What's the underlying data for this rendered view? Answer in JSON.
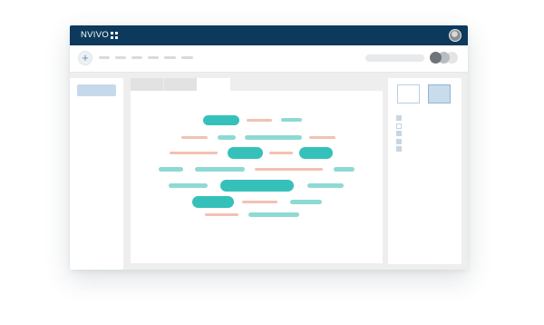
{
  "app": {
    "title": "NVIVO",
    "logo_icon": "nvivo-four-dots-icon"
  },
  "colors": {
    "titlebar": "#0d3a5c",
    "accent_teal": "#35c1b9",
    "teal_light": "#8ed9d4",
    "salmon": "#f2c1b2",
    "selected_blue": "#c9dcec"
  },
  "toolbar": {
    "add_icon": "plus-icon",
    "add_label": "+",
    "menu_items": 6,
    "view_toggle_icon": "toggle-icon"
  },
  "header": {
    "avatar_icon": "user-avatar-icon"
  },
  "sidebar": {
    "items": 1
  },
  "tabs": {
    "count": 3,
    "active_index": 2
  },
  "right_panel": {
    "view_options": [
      "list-view-icon",
      "grid-view-icon"
    ],
    "selected_view": 1,
    "list_items": 5
  },
  "word_cloud": {
    "description_icon": "word-cloud-icon"
  }
}
